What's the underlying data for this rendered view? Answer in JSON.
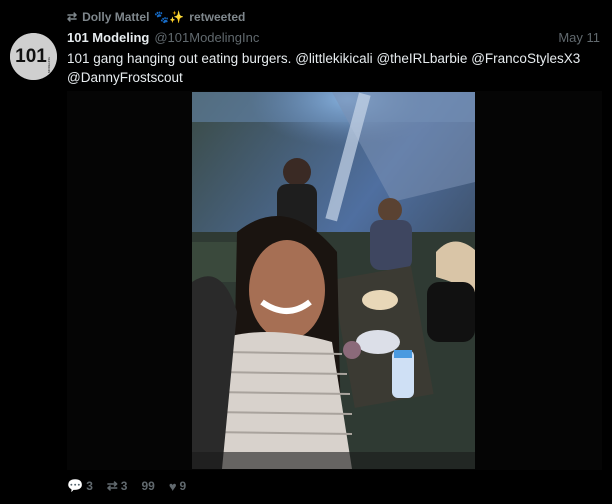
{
  "retweet": {
    "icon": "retweet-icon",
    "user": "Dolly Mattel",
    "emoji": "🐾✨",
    "suffix": "retweeted"
  },
  "tweet": {
    "avatar_text": "101",
    "avatar_subtext": "MODELING",
    "name": "101 Modeling",
    "handle": "@101ModelingInc",
    "date": "May 11",
    "text": "101 gang hanging out eating burgers.",
    "mentions": [
      "@littlekikicali",
      "@theIRLbarbie",
      "@FrancoStylesX3",
      "@DannyFrostscout"
    ]
  },
  "actions": {
    "reply_count": "3",
    "retweet_count": "3",
    "quote_label": "99",
    "like_count": "9"
  },
  "colors": {
    "background": "#000000",
    "primary_text": "#e7ecef",
    "secondary_text": "#61696e"
  }
}
